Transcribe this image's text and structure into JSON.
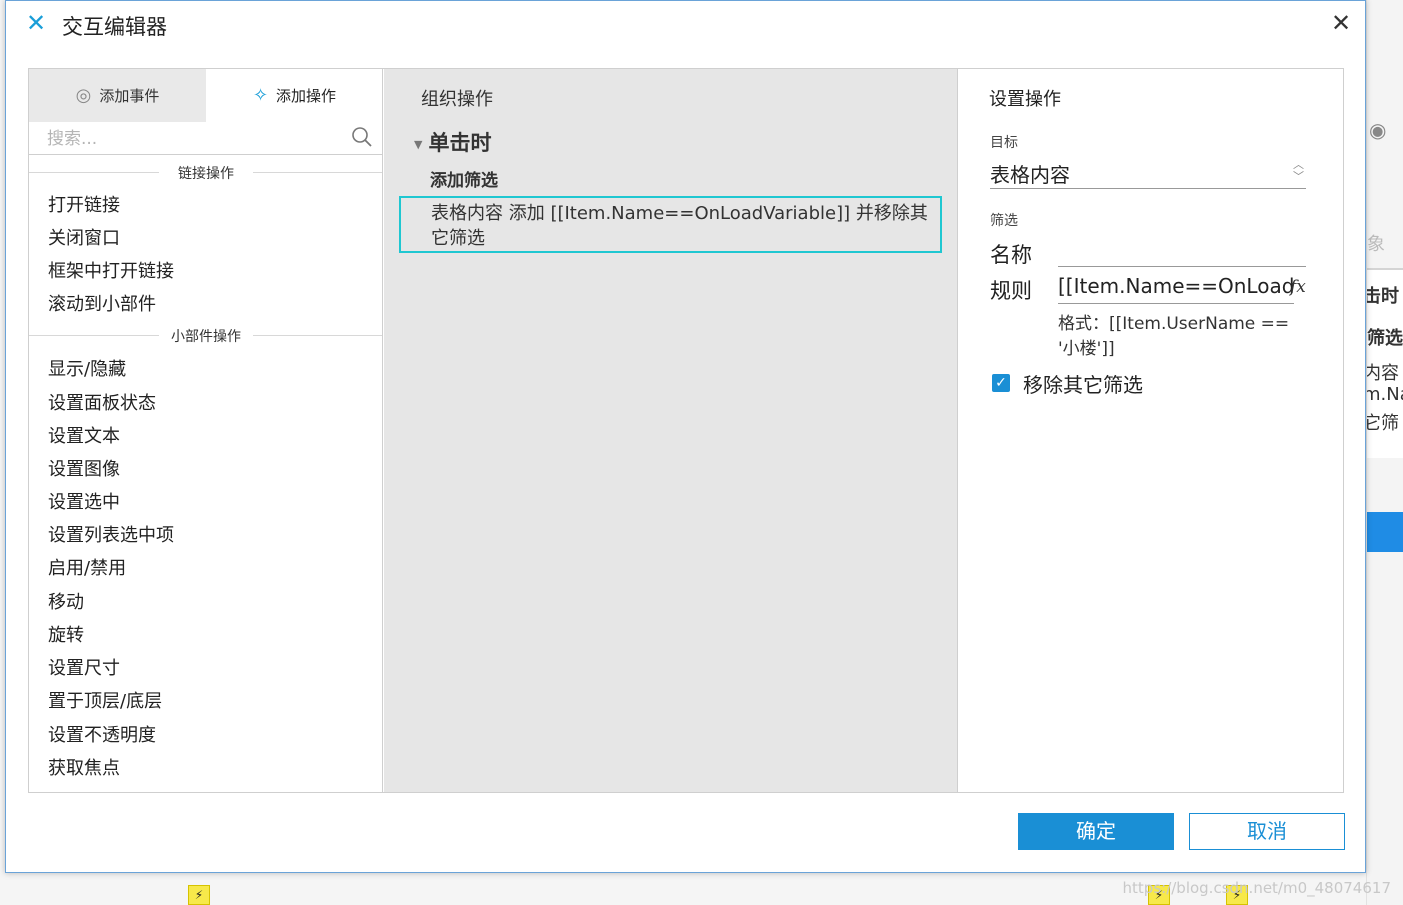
{
  "dialog": {
    "title": "交互编辑器",
    "close_glyph": "✕"
  },
  "left": {
    "tabs": [
      {
        "label": "添加事件",
        "icon": "cursor-click-icon"
      },
      {
        "label": "添加操作",
        "icon": "sparkle-icon"
      }
    ],
    "search_placeholder": "搜索...",
    "sections": [
      {
        "title": "链接操作",
        "items": [
          "打开链接",
          "关闭窗口",
          "框架中打开链接",
          "滚动到小部件"
        ]
      },
      {
        "title": "小部件操作",
        "items": [
          "显示/隐藏",
          "设置面板状态",
          "设置文本",
          "设置图像",
          "设置选中",
          "设置列表选中项",
          "启用/禁用",
          "移动",
          "旋转",
          "设置尺寸",
          "置于顶层/底层",
          "设置不透明度",
          "获取焦点"
        ]
      }
    ]
  },
  "middle": {
    "title": "组织操作",
    "event": "单击时",
    "case": "添加筛选",
    "action_text": "表格内容 添加 [[Item.Name==OnLoadVariable]] 并移除其它筛选"
  },
  "right": {
    "title": "设置操作",
    "target_label": "目标",
    "target_value": "表格内容",
    "filter_label": "筛选",
    "name_label": "名称",
    "name_value": "",
    "rule_label": "规则",
    "rule_value": "[[Item.Name==OnLoadVariable]]",
    "fx": "fx",
    "hint": "格式：[[Item.UserName == '小楼']]",
    "checkbox_label": "移除其它筛选",
    "checkbox_checked": true
  },
  "footer": {
    "ok_label": "确定",
    "cancel_label": "取消"
  },
  "background": {
    "fragments": [
      "象",
      "击时",
      "筛选",
      "内容",
      "m.Na",
      "它筛"
    ],
    "watermark": "https://blog.csdn.net/m0_48074617"
  },
  "colors": {
    "accent": "#1a8fd5",
    "highlight_border": "#1fc7d1",
    "middle_bg": "#e6e6e6"
  }
}
